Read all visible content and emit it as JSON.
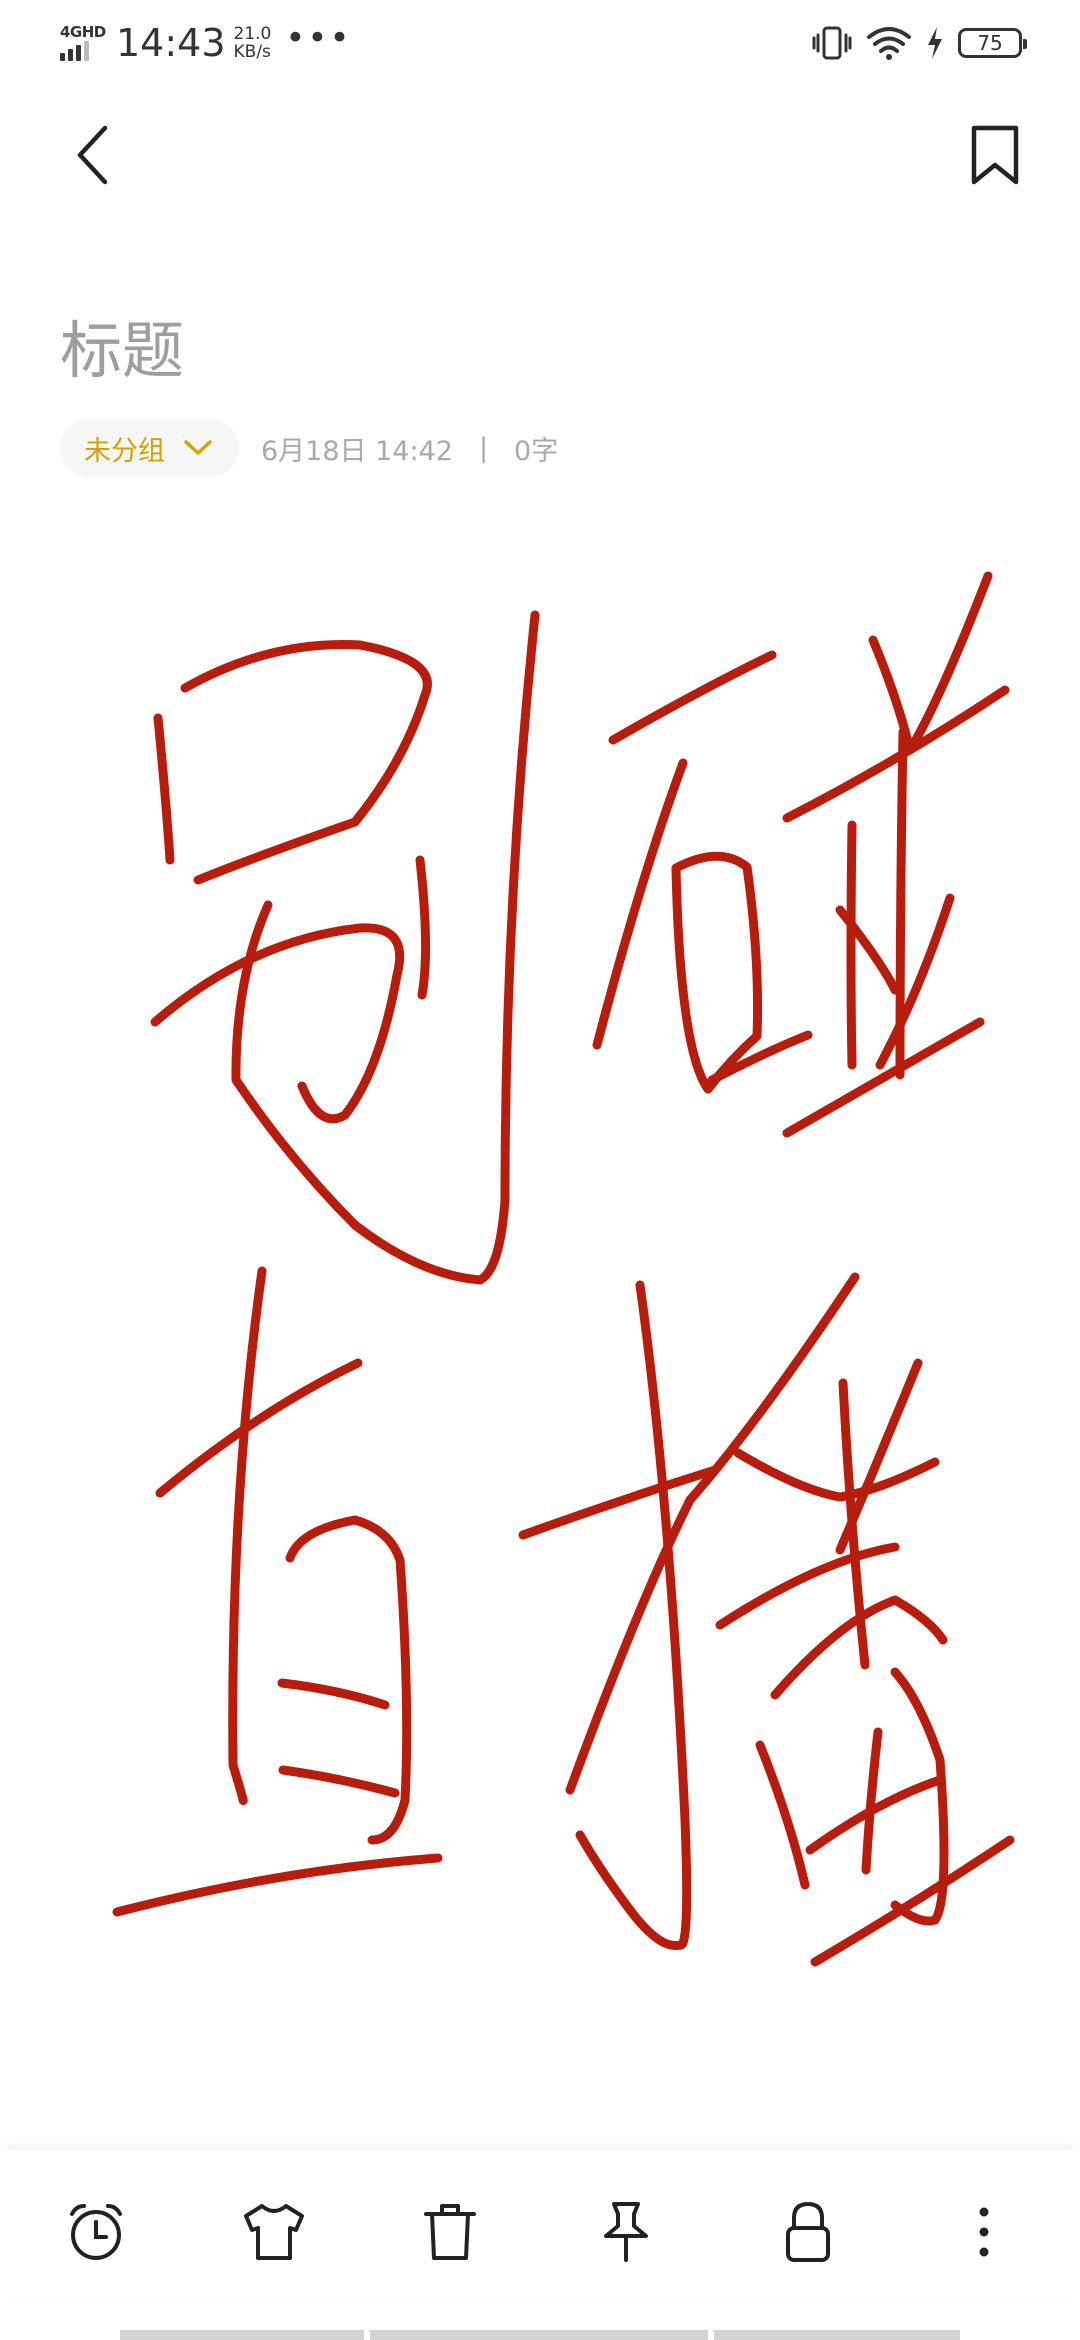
{
  "status_bar": {
    "network": "4GHD",
    "time": "14:43",
    "speed_value": "21.0",
    "speed_unit": "KB/s",
    "more": "•••",
    "battery": "75"
  },
  "note": {
    "title_placeholder": "标题",
    "group_label": "未分组",
    "date": "6月18日 14:42",
    "separator": "|",
    "word_count": "0字"
  },
  "handwriting": {
    "description_text": "别碰直播",
    "ink_color": "#b71c0c"
  },
  "toolbar": {
    "icons": [
      "alarm-icon",
      "shirt-icon",
      "trash-icon",
      "pin-icon",
      "lock-icon",
      "more-vertical-icon"
    ]
  },
  "colors": {
    "accent": "#d6a200",
    "ink": "#b71c0c",
    "muted_text": "#a9a9a9"
  }
}
